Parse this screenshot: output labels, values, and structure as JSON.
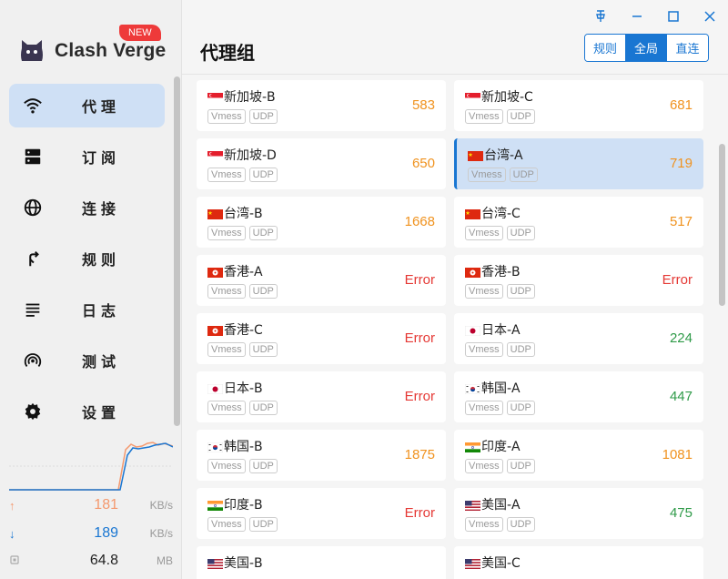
{
  "app": {
    "logo_text": "Clash Verge",
    "badge": "NEW"
  },
  "sidebar": {
    "items": [
      {
        "label": "代理",
        "icon": "wifi-icon",
        "active": true
      },
      {
        "label": "订阅",
        "icon": "dns-icon",
        "active": false
      },
      {
        "label": "连接",
        "icon": "globe-icon",
        "active": false
      },
      {
        "label": "规则",
        "icon": "fork-icon",
        "active": false
      },
      {
        "label": "日志",
        "icon": "list-icon",
        "active": false
      },
      {
        "label": "测试",
        "icon": "radar-icon",
        "active": false
      },
      {
        "label": "设置",
        "icon": "gear-icon",
        "active": false
      }
    ]
  },
  "traffic": {
    "upload": {
      "value": "181",
      "unit": "KB/s",
      "color": "#f4986d"
    },
    "download": {
      "value": "189",
      "unit": "KB/s",
      "color": "#1976d2"
    },
    "memory": {
      "value": "64.8",
      "unit": "MB"
    }
  },
  "header": {
    "title": "代理组",
    "modes": [
      {
        "label": "规则",
        "active": false
      },
      {
        "label": "全局",
        "active": true
      },
      {
        "label": "直连",
        "active": false
      }
    ]
  },
  "colors": {
    "accent": "#1976d2",
    "warn": "#f0921e",
    "error": "#e53935",
    "good": "#2e9a48"
  },
  "proxies": [
    {
      "name": "新加坡-B",
      "flag": "sg",
      "tags": [
        "Vmess",
        "UDP"
      ],
      "delay": "583",
      "status": "warn"
    },
    {
      "name": "新加坡-C",
      "flag": "sg",
      "tags": [
        "Vmess",
        "UDP"
      ],
      "delay": "681",
      "status": "warn"
    },
    {
      "name": "新加坡-D",
      "flag": "sg",
      "tags": [
        "Vmess",
        "UDP"
      ],
      "delay": "650",
      "status": "warn"
    },
    {
      "name": "台湾-A",
      "flag": "cn",
      "tags": [
        "Vmess",
        "UDP"
      ],
      "delay": "719",
      "status": "warn",
      "selected": true
    },
    {
      "name": "台湾-B",
      "flag": "cn",
      "tags": [
        "Vmess",
        "UDP"
      ],
      "delay": "1668",
      "status": "warn"
    },
    {
      "name": "台湾-C",
      "flag": "cn",
      "tags": [
        "Vmess",
        "UDP"
      ],
      "delay": "517",
      "status": "warn"
    },
    {
      "name": "香港-A",
      "flag": "hk",
      "tags": [
        "Vmess",
        "UDP"
      ],
      "delay": "Error",
      "status": "error"
    },
    {
      "name": "香港-B",
      "flag": "hk",
      "tags": [
        "Vmess",
        "UDP"
      ],
      "delay": "Error",
      "status": "error"
    },
    {
      "name": "香港-C",
      "flag": "hk",
      "tags": [
        "Vmess",
        "UDP"
      ],
      "delay": "Error",
      "status": "error"
    },
    {
      "name": "日本-A",
      "flag": "jp",
      "tags": [
        "Vmess",
        "UDP"
      ],
      "delay": "224",
      "status": "good"
    },
    {
      "name": "日本-B",
      "flag": "jp",
      "tags": [
        "Vmess",
        "UDP"
      ],
      "delay": "Error",
      "status": "error"
    },
    {
      "name": "韩国-A",
      "flag": "kr",
      "tags": [
        "Vmess",
        "UDP"
      ],
      "delay": "447",
      "status": "good"
    },
    {
      "name": "韩国-B",
      "flag": "kr",
      "tags": [
        "Vmess",
        "UDP"
      ],
      "delay": "1875",
      "status": "warn"
    },
    {
      "name": "印度-A",
      "flag": "in",
      "tags": [
        "Vmess",
        "UDP"
      ],
      "delay": "1081",
      "status": "warn"
    },
    {
      "name": "印度-B",
      "flag": "in",
      "tags": [
        "Vmess",
        "UDP"
      ],
      "delay": "Error",
      "status": "error"
    },
    {
      "name": "美国-A",
      "flag": "us",
      "tags": [
        "Vmess",
        "UDP"
      ],
      "delay": "475",
      "status": "good"
    },
    {
      "name": "美国-B",
      "flag": "us",
      "tags": [],
      "delay": "",
      "status": "error"
    },
    {
      "name": "美国-C",
      "flag": "us",
      "tags": [],
      "delay": "",
      "status": "good"
    }
  ]
}
